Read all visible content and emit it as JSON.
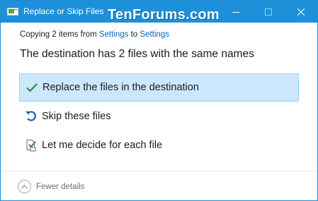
{
  "window": {
    "title": "Replace or Skip Files",
    "watermark": "TenForums.com",
    "accent": "#1e90d9"
  },
  "titlebar_buttons": {
    "minimize": "minimize-icon",
    "maximize": "maximize-icon",
    "close": "close-icon"
  },
  "summary": {
    "prefix": "Copying 2 items from ",
    "source": "Settings",
    "to": " to ",
    "destination": "Settings"
  },
  "headline": "The destination has 2 files with the same names",
  "options": [
    {
      "label": "Replace the files in the destination",
      "icon": "checkmark-icon",
      "selected": true
    },
    {
      "label": "Skip these files",
      "icon": "skip-arrow-icon",
      "selected": false
    },
    {
      "label": "Let me decide for each file",
      "icon": "decide-files-icon",
      "selected": false
    }
  ],
  "footer": {
    "details_label": "Fewer details",
    "icon": "chevron-up-icon"
  }
}
